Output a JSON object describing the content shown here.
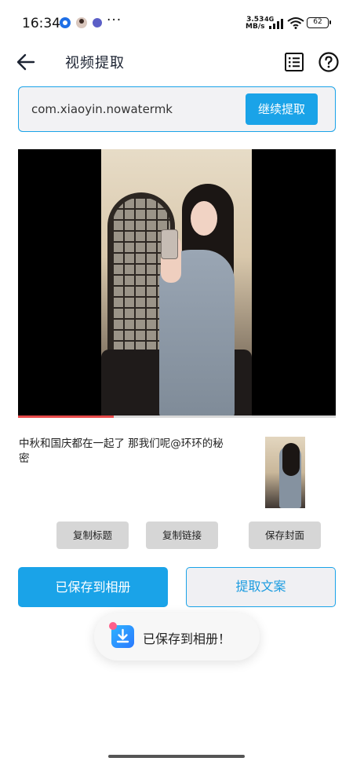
{
  "status_bar": {
    "time": "16:34",
    "more": "···",
    "net_speed_value": "3.53",
    "net_speed_unit": "MB/s",
    "network_type": "4G",
    "battery": "62"
  },
  "header": {
    "title": "视频提取"
  },
  "url_bar": {
    "value": "com.xiaoyin.nowatermk",
    "extract_button": "继续提取"
  },
  "video": {
    "progress_fraction": 0.3
  },
  "caption": {
    "text": "中秋和国庆都在一起了 那我们呢@环环的秘密"
  },
  "actions": {
    "copy_title": "复制标题",
    "copy_link": "复制链接",
    "save_cover": "保存封面"
  },
  "buttons": {
    "saved": "已保存到相册",
    "extract_text": "提取文案"
  },
  "toast": {
    "text": "已保存到相册！"
  },
  "colors": {
    "accent": "#1aa3e8",
    "progress": "#e84a4a"
  }
}
